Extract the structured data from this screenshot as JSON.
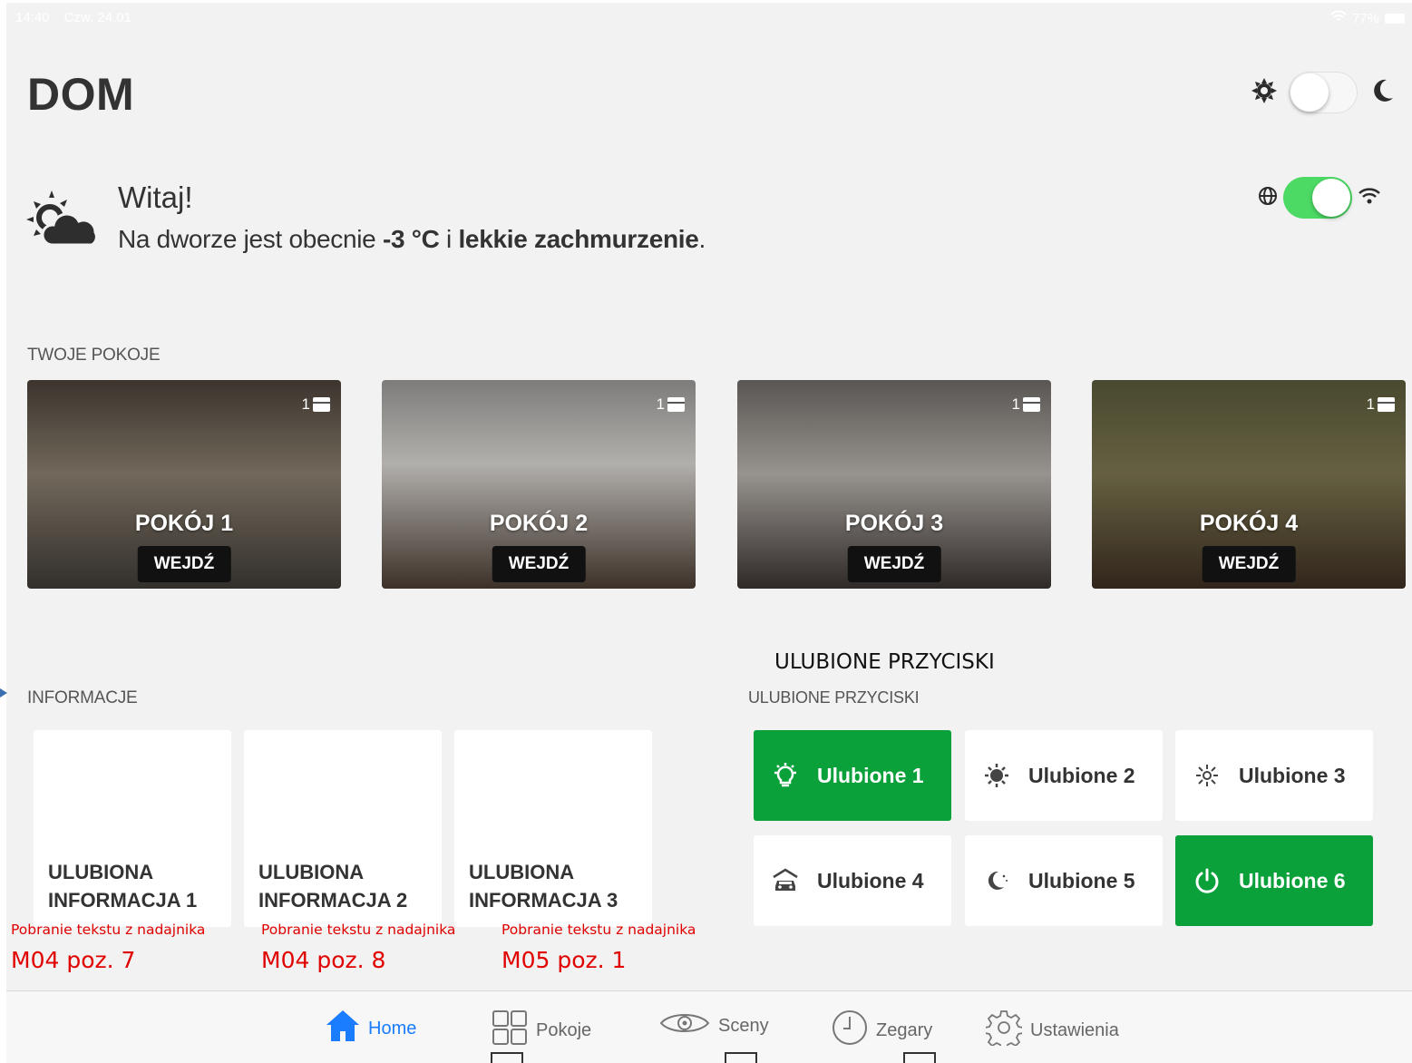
{
  "status_bar": {
    "time": "14:40",
    "date": "Czw. 24.01",
    "battery": "77%"
  },
  "page_title": "DOM",
  "greeting": "Witaj!",
  "weather": {
    "prefix": "Na dworze jest obecnie ",
    "temperature": "-3 °C",
    "joiner": " i ",
    "condition": "lekkie zachmurzenie",
    "suffix": "."
  },
  "rooms_section": "TWOJE POKOJE",
  "rooms": [
    {
      "name": "POKÓJ 1",
      "button": "WEJDŹ",
      "count": "1"
    },
    {
      "name": "POKÓJ 2",
      "button": "WEJDŹ",
      "count": "1"
    },
    {
      "name": "POKÓJ 3",
      "button": "WEJDŹ",
      "count": "1"
    },
    {
      "name": "POKÓJ 4",
      "button": "WEJDŹ",
      "count": "1"
    }
  ],
  "info_section": "INFORMACJE",
  "info_tiles": [
    {
      "line1": "ULUBIONA",
      "line2": "INFORMACJA 1"
    },
    {
      "line1": "ULUBIONA",
      "line2": "INFORMACJA 2"
    },
    {
      "line1": "ULUBIONA",
      "line2": "INFORMACJA 3"
    }
  ],
  "favorites_annotation": "ULUBIONE PRZYCISKI",
  "favorites_section": "ULUBIONE PRZYCISKI",
  "favorites": [
    {
      "label": "Ulubione 1",
      "icon": "lightbulb-icon",
      "active": true
    },
    {
      "label": "Ulubione 2",
      "icon": "sun-bright-icon",
      "active": false
    },
    {
      "label": "Ulubione 3",
      "icon": "sun-dim-icon",
      "active": false
    },
    {
      "label": "Ulubione 4",
      "icon": "garage-icon",
      "active": false
    },
    {
      "label": "Ulubione 5",
      "icon": "moon-icon",
      "active": false
    },
    {
      "label": "Ulubione 6",
      "icon": "power-icon",
      "active": true
    }
  ],
  "annotations": [
    {
      "small": "Pobranie tekstu z nadajnika",
      "big": "M04 poz. 7"
    },
    {
      "small": "Pobranie tekstu z nadajnika",
      "big": "M04 poz. 8"
    },
    {
      "small": "Pobranie tekstu z nadajnika",
      "big": "M05 poz. 1"
    }
  ],
  "tabs": [
    {
      "label": "Home",
      "icon": "home-icon",
      "active": true
    },
    {
      "label": "Pokoje",
      "icon": "grid-icon",
      "active": false
    },
    {
      "label": "Sceny",
      "icon": "eye-icon",
      "active": false
    },
    {
      "label": "Zegary",
      "icon": "clock-icon",
      "active": false
    },
    {
      "label": "Ustawienia",
      "icon": "gear-icon",
      "active": false
    }
  ],
  "colors": {
    "accent_green": "#0aa03a",
    "toggle_green": "#4cd964",
    "tab_active": "#1a7cff",
    "annotation_red": "#e00000"
  },
  "toggles": {
    "theme_dark": false,
    "network_online": true
  }
}
